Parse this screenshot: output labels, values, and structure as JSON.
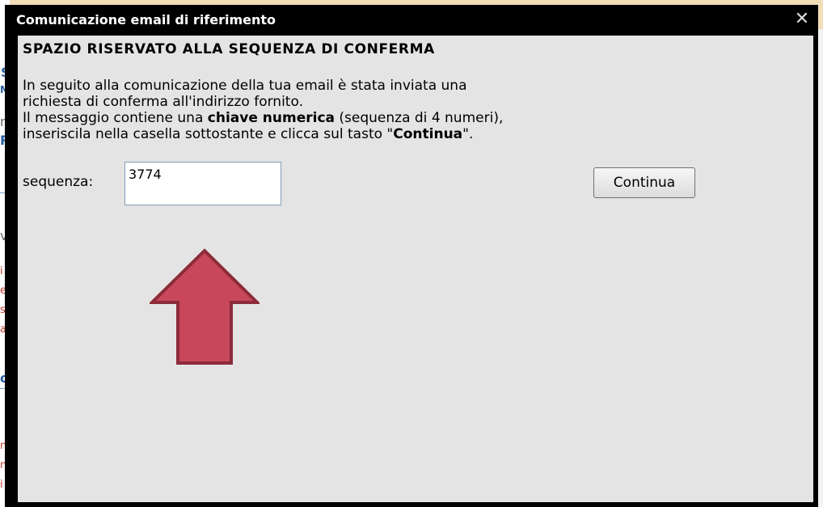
{
  "background": {
    "fragments": [
      "S",
      "M",
      "n",
      "R",
      "v",
      "i",
      "e",
      "se",
      "a",
      "o",
      "n",
      "nd",
      "i"
    ]
  },
  "dialog": {
    "title": "Comunicazione email di riferimento",
    "close_icon": "close-icon",
    "heading": "SPAZIO RISERVATO ALLA SEQUENZA DI CONFERMA",
    "message": {
      "line1": "In seguito alla comunicazione della tua email è stata inviata una",
      "line2": "richiesta di conferma all'indirizzo fornito.",
      "line3_prefix": "Il messaggio contiene una ",
      "line3_bold": "chiave numerica",
      "line3_suffix": " (sequenza di 4 numeri),",
      "line4_prefix": "inseriscila nella casella sottostante e clicca sul tasto \"",
      "line4_bold": "Continua",
      "line4_suffix": "\"."
    },
    "sequence_label": "sequenza:",
    "sequence_value": "3774",
    "continue_label": "Continua"
  },
  "annotation": {
    "arrow_icon": "up-arrow-icon",
    "fill_color": "#c9475a",
    "stroke_color": "#8c2b3a"
  },
  "colors": {
    "titlebar": "#000000",
    "body": "#e4e4e4",
    "input_border": "#7f9db9"
  }
}
